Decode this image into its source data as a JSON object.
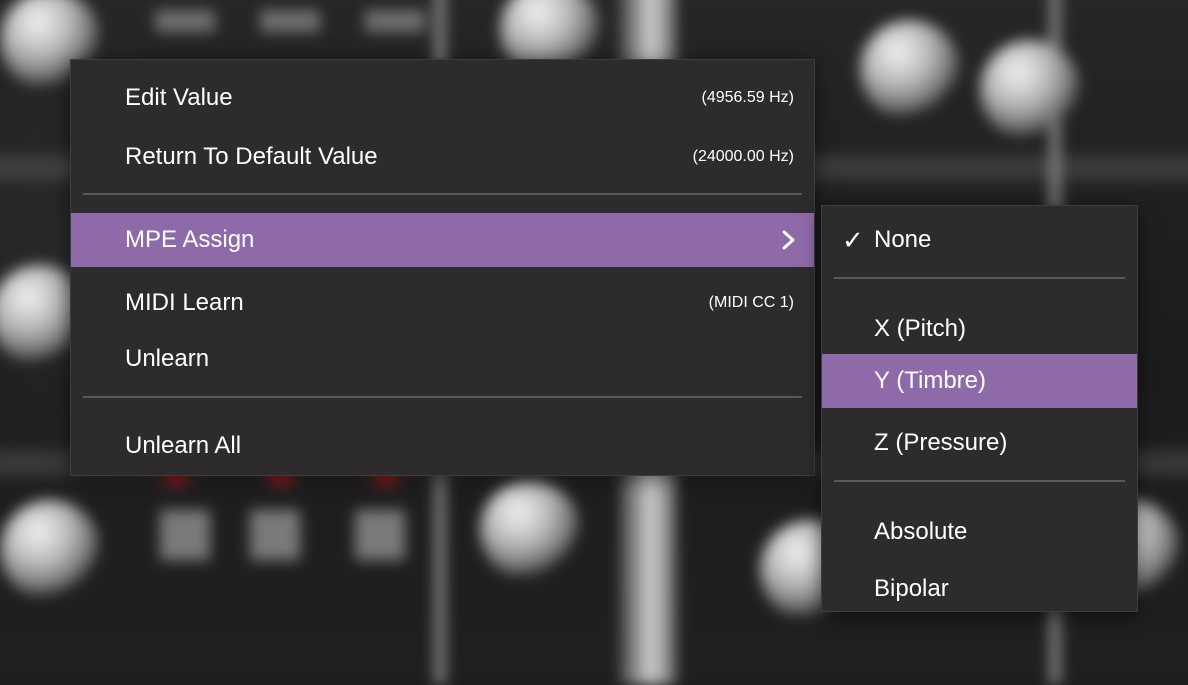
{
  "main_menu": {
    "items": [
      {
        "label": "Edit Value",
        "value": "(4956.59 Hz)"
      },
      {
        "label": "Return To Default Value",
        "value": "(24000.00 Hz)"
      },
      {
        "label": "MPE Assign",
        "submenu_icon": "chevron-right-icon",
        "highlighted": true
      },
      {
        "label": "MIDI Learn",
        "value": "(MIDI CC 1)"
      },
      {
        "label": "Unlearn"
      },
      {
        "label": "Unlearn All"
      }
    ]
  },
  "submenu": {
    "items": [
      {
        "label": "None",
        "checked": true,
        "check_icon": "checkmark-icon",
        "check_glyph": "✓"
      },
      {
        "label": "X (Pitch)"
      },
      {
        "label": "Y (Timbre)",
        "highlighted": true
      },
      {
        "label": "Z (Pressure)"
      },
      {
        "label": "Absolute"
      },
      {
        "label": "Bipolar"
      }
    ]
  },
  "colors": {
    "menu_background": "#2d2b2c",
    "highlight": "#8f6aa9",
    "separator": "#5a5859",
    "text": "#ffffff"
  }
}
